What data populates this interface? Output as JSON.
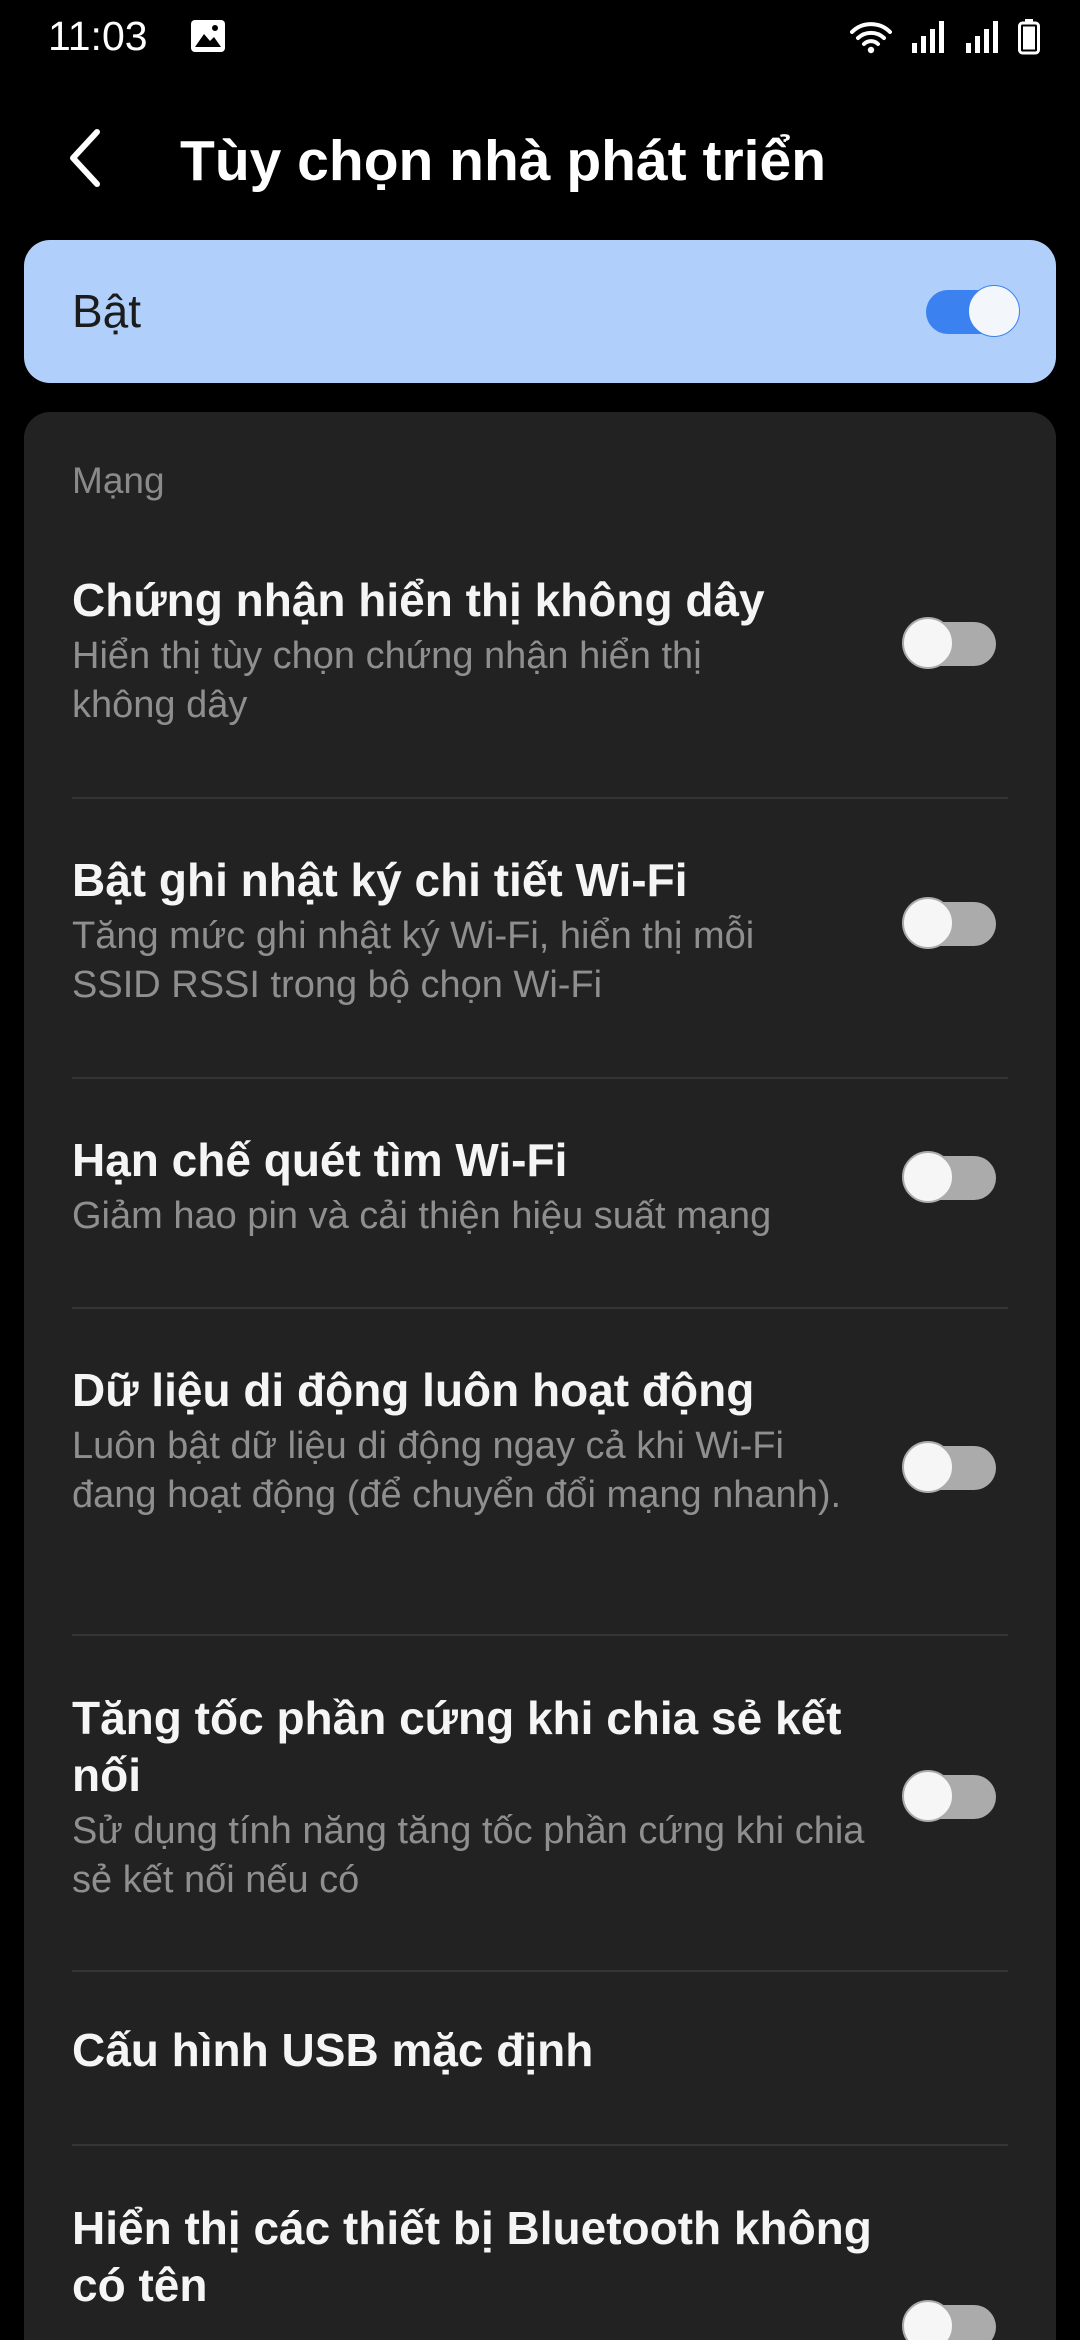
{
  "status_bar": {
    "time": "11:03",
    "icons": [
      "gallery-icon",
      "wifi-icon",
      "signal-icon",
      "signal-icon",
      "battery-icon"
    ]
  },
  "header": {
    "back_icon": "chevron-left-icon",
    "title": "Tùy chọn nhà phát triển"
  },
  "master_switch": {
    "label": "Bật",
    "enabled": true,
    "accent_color": "#3b82f0",
    "card_color": "#b0d0fb"
  },
  "section": {
    "title": "Mạng"
  },
  "items": [
    {
      "title": "Chứng nhận hiển thị không dây",
      "summary": "Hiển thị tùy chọn chứng nhận hiển thị không dây",
      "enabled": false
    },
    {
      "title": "Bật ghi nhật ký chi tiết Wi-Fi",
      "summary": "Tăng mức ghi nhật ký Wi-Fi, hiển thị mỗi SSID RSSI trong bộ chọn Wi-Fi",
      "enabled": false
    },
    {
      "title": "Hạn chế quét tìm Wi-Fi",
      "summary": "Giảm hao pin và cải thiện hiệu suất mạng",
      "enabled": false
    },
    {
      "title": "Dữ liệu di động luôn hoạt động",
      "summary": "Luôn bật dữ liệu di động ngay cả khi Wi-Fi đang hoạt động (để chuyển đổi mạng nhanh).",
      "enabled": false
    },
    {
      "title": "Tăng tốc phần cứng khi chia sẻ kết nối",
      "summary": "Sử dụng tính năng tăng tốc phần cứng khi chia sẻ kết nối nếu có",
      "enabled": false
    },
    {
      "title": "Cấu hình USB mặc định"
    },
    {
      "title": "Hiển thị các thiết bị Bluetooth không có tên",
      "enabled": false
    }
  ]
}
